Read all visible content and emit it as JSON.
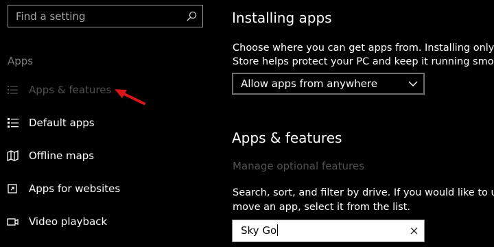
{
  "search": {
    "placeholder": "Find a setting",
    "icon": "search-icon"
  },
  "sidebar": {
    "section_label": "Apps",
    "items": [
      {
        "label": "Apps & features",
        "icon": "list-icon",
        "state": "selected"
      },
      {
        "label": "Default apps",
        "icon": "default-apps-icon",
        "state": "normal"
      },
      {
        "label": "Offline maps",
        "icon": "offline-maps-icon",
        "state": "normal"
      },
      {
        "label": "Apps for websites",
        "icon": "apps-for-websites-icon",
        "state": "normal"
      },
      {
        "label": "Video playback",
        "icon": "video-icon",
        "state": "normal"
      }
    ]
  },
  "installing": {
    "heading": "Installing apps",
    "line1": "Choose where you can get apps from. Installing only apps",
    "line2": "Store helps protect your PC and keep it running smoothly.",
    "dropdown_value": "Allow apps from anywhere"
  },
  "features": {
    "heading": "Apps & features",
    "manage_link": "Manage optional features",
    "line1": "Search, sort, and filter by drive. If you would like to uninsta",
    "line2": "move an app, select it from the list.",
    "filter_value": "Sky Go"
  },
  "colors": {
    "background": "#000000",
    "text": "#ffffff",
    "disabled_text": "#4f4f4f",
    "annotation_arrow": "#d9141b"
  }
}
